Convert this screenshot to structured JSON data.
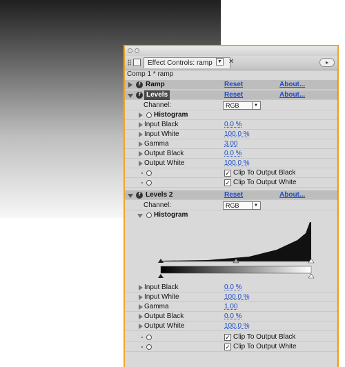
{
  "window": {
    "tab_title": "Effect Controls: ramp",
    "tab_menu": "▼",
    "tab_close": "✕",
    "panel_menu": "▸"
  },
  "breadcrumb": "Comp 1 * ramp",
  "effects": {
    "ramp": {
      "name": "Ramp",
      "reset": "Reset",
      "about": "About..."
    },
    "levels": {
      "name": "Levels",
      "reset": "Reset",
      "about": "About...",
      "channel_label": "Channel:",
      "channel_value": "RGB",
      "histogram_label": "Histogram",
      "input_black": {
        "label": "Input Black",
        "value": "0.0 %"
      },
      "input_white": {
        "label": "Input White",
        "value": "100.0 %"
      },
      "gamma": {
        "label": "Gamma",
        "value": "3.00"
      },
      "output_black": {
        "label": "Output Black",
        "value": "0.0 %"
      },
      "output_white": {
        "label": "Output White",
        "value": "100.0 %"
      },
      "clip_black": {
        "label": "Clip To Output Black",
        "checked": true
      },
      "clip_white": {
        "label": "Clip To Output White",
        "checked": true
      }
    },
    "levels2": {
      "name": "Levels 2",
      "reset": "Reset",
      "about": "About...",
      "channel_label": "Channel:",
      "channel_value": "RGB",
      "histogram_label": "Histogram",
      "input_black": {
        "label": "Input Black",
        "value": "0.0 %"
      },
      "input_white": {
        "label": "Input White",
        "value": "100.0 %"
      },
      "gamma": {
        "label": "Gamma",
        "value": "1.00"
      },
      "output_black": {
        "label": "Output Black",
        "value": "0.0 %"
      },
      "output_white": {
        "label": "Output White",
        "value": "100.0 %"
      },
      "clip_black": {
        "label": "Clip To Output Black",
        "checked": true
      },
      "clip_white": {
        "label": "Clip To Output White",
        "checked": true
      }
    }
  },
  "check_mark": "✓",
  "select_arrow": "▼",
  "fx_glyph": "f",
  "colors": {
    "panel_border": "#f0a42a",
    "link": "#1c4cc9",
    "highlight": "#4a4a4a"
  }
}
